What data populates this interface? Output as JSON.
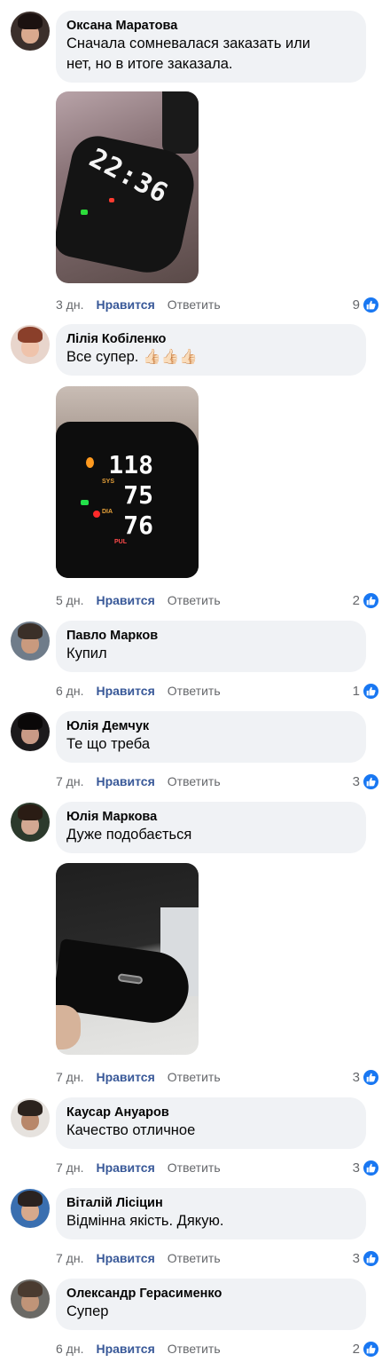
{
  "like_label": "Нравится",
  "reply_label": "Ответить",
  "colors": {
    "bubble": "#f0f2f5",
    "link": "#385898",
    "meta": "#65676b",
    "like_blue": "#1877f2"
  },
  "comments": [
    {
      "author": "Оксана Маратова",
      "text_line1": "Сначала сомневалася заказать или",
      "text_line2": "нет, но в итоге заказала.",
      "time": "3 дн.",
      "reactions": "9",
      "photo": "smart-watch-clock-photo"
    },
    {
      "author": "Лілія Кобіленко",
      "text": "Все супер. 👍🏻👍🏻👍🏻",
      "time": "5 дн.",
      "reactions": "2",
      "photo": "blood-pressure-monitor-photo"
    },
    {
      "author": "Павло Марков",
      "text": "Купил",
      "time": "6 дн.",
      "reactions": "1"
    },
    {
      "author": "Юлія Демчук",
      "text": "Те що треба",
      "time": "7 дн.",
      "reactions": "3"
    },
    {
      "author": "Юлія Маркова",
      "text": "Дуже подобається",
      "time": "7 дн.",
      "reactions": "3",
      "photo": "device-charging-port-photo"
    },
    {
      "author": "Каусар Ануаров",
      "text": "Качество отличное",
      "time": "7 дн.",
      "reactions": "3"
    },
    {
      "author": "Віталій Лісіцин",
      "text": "Відмінна якість. Дякую.",
      "time": "7 дн.",
      "reactions": "3"
    },
    {
      "author": "Олександр Герасименко",
      "text": "Супер",
      "time": "6 дн.",
      "reactions": "2"
    }
  ],
  "photo1": {
    "clock": "22:36"
  },
  "photo2": {
    "sys": "118",
    "dia": "75",
    "pul": "76",
    "sys_label": "SYS",
    "dia_label": "DIA",
    "pul_label": "PUL"
  }
}
